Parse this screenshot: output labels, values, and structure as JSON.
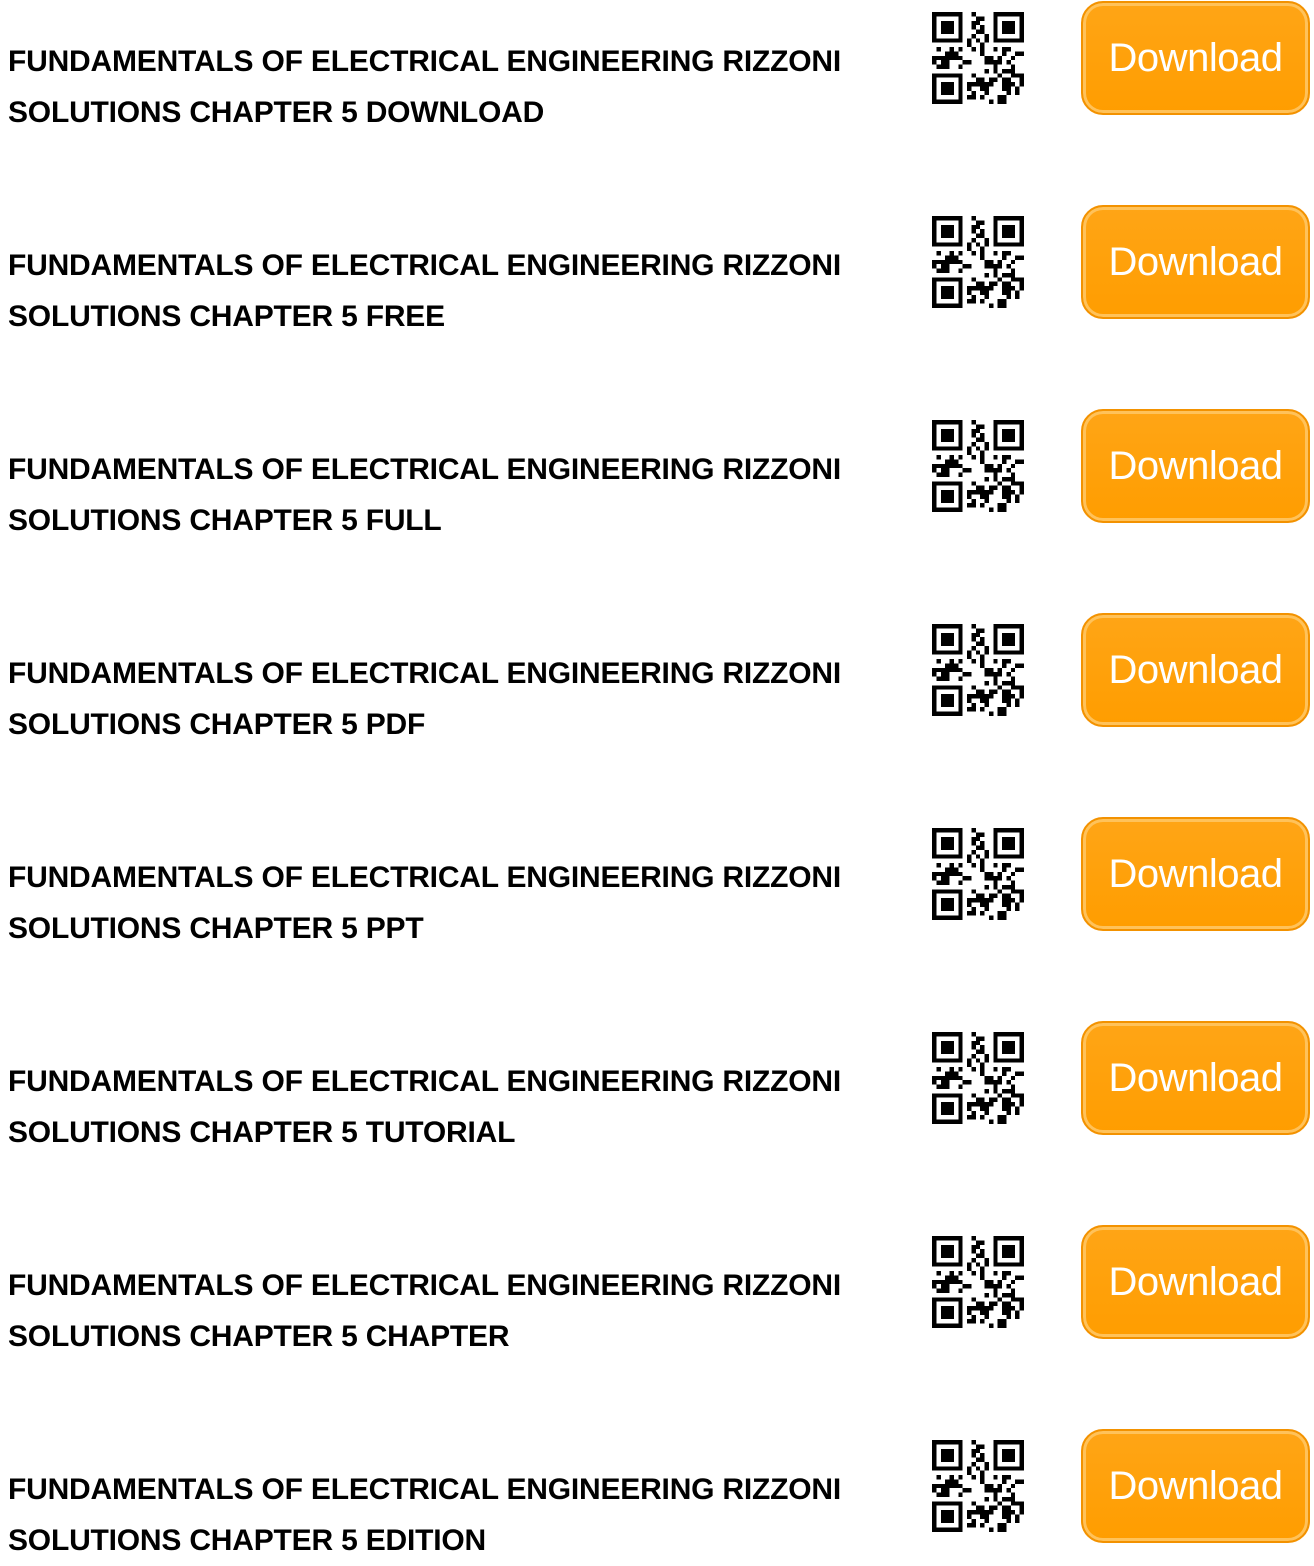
{
  "entries": [
    {
      "title": "FUNDAMENTALS OF ELECTRICAL ENGINEERING RIZZONI SOLUTIONS CHAPTER 5 DOWNLOAD",
      "button_label": "Download",
      "qr_icon": "qr-code-icon"
    },
    {
      "title": "FUNDAMENTALS OF ELECTRICAL ENGINEERING RIZZONI SOLUTIONS CHAPTER 5 FREE",
      "button_label": "Download",
      "qr_icon": "qr-code-icon"
    },
    {
      "title": "FUNDAMENTALS OF ELECTRICAL ENGINEERING RIZZONI SOLUTIONS CHAPTER 5 FULL",
      "button_label": "Download",
      "qr_icon": "qr-code-icon"
    },
    {
      "title": "FUNDAMENTALS OF ELECTRICAL ENGINEERING RIZZONI SOLUTIONS CHAPTER 5 PDF",
      "button_label": "Download",
      "qr_icon": "qr-code-icon"
    },
    {
      "title": "FUNDAMENTALS OF ELECTRICAL ENGINEERING RIZZONI SOLUTIONS CHAPTER 5 PPT",
      "button_label": "Download",
      "qr_icon": "qr-code-icon"
    },
    {
      "title": "FUNDAMENTALS OF ELECTRICAL ENGINEERING RIZZONI SOLUTIONS CHAPTER 5 TUTORIAL",
      "button_label": "Download",
      "qr_icon": "qr-code-icon"
    },
    {
      "title": "FUNDAMENTALS OF ELECTRICAL ENGINEERING RIZZONI SOLUTIONS CHAPTER 5 CHAPTER",
      "button_label": "Download",
      "qr_icon": "qr-code-icon"
    },
    {
      "title": "FUNDAMENTALS OF ELECTRICAL ENGINEERING RIZZONI SOLUTIONS CHAPTER 5 EDITION",
      "button_label": "Download",
      "qr_icon": "qr-code-icon"
    }
  ],
  "colors": {
    "button_orange": "#ff9f0a",
    "button_border": "#f39200",
    "button_text": "#ffffff",
    "title_text": "#000000",
    "background": "#ffffff"
  }
}
